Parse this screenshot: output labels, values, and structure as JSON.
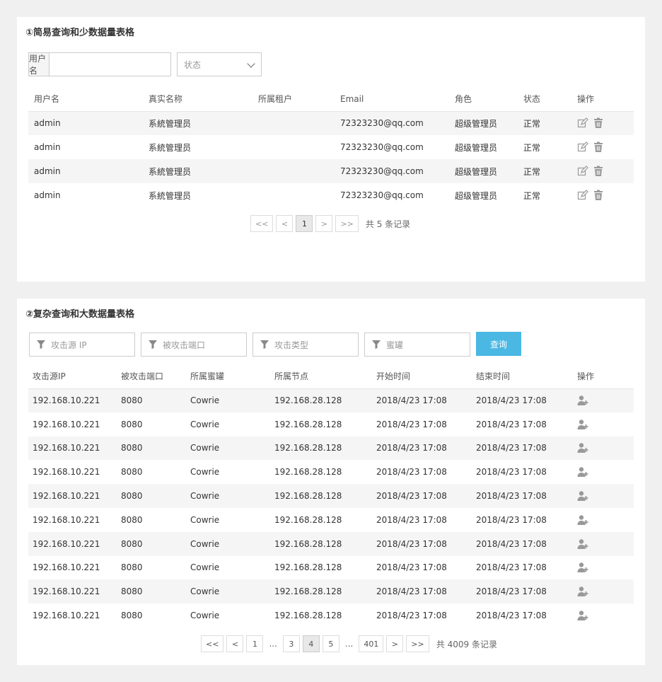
{
  "panel1": {
    "title": "①简易查询和少数据量表格",
    "search": {
      "addon_label": "用户名",
      "input_value": "",
      "status_placeholder": "状态"
    },
    "columns": [
      "用户名",
      "真实名称",
      "所属租户",
      "Email",
      "角色",
      "状态",
      "操作"
    ],
    "rows": [
      [
        "admin",
        "系統管理员",
        "",
        "72323230@qq.com",
        "超级管理员",
        "正常"
      ],
      [
        "admin",
        "系統管理员",
        "",
        "72323230@qq.com",
        "超级管理员",
        "正常"
      ],
      [
        "admin",
        "系統管理员",
        "",
        "72323230@qq.com",
        "超级管理员",
        "正常"
      ],
      [
        "admin",
        "系統管理员",
        "",
        "72323230@qq.com",
        "超级管理员",
        "正常"
      ]
    ],
    "row_actions": [
      "edit-icon",
      "trash-icon"
    ],
    "pager": {
      "first": "<<",
      "prev": "<",
      "current": "1",
      "next": ">",
      "last": ">>",
      "total_text": "共 5 条记录"
    }
  },
  "panel2": {
    "title": "②复杂查询和大数据量表格",
    "filters": [
      "攻击源 IP",
      "被攻击端口",
      "攻击类型",
      "蜜罐"
    ],
    "query_label": "查询",
    "columns": [
      "攻击源IP",
      "被攻击端口",
      "所属蜜罐",
      "所属节点",
      "开始时间",
      "结束时间",
      "操作"
    ],
    "rows": [
      [
        "192.168.10.221",
        "8080",
        "Cowrie",
        "192.168.28.128",
        "2018/4/23 17:08",
        "2018/4/23 17:08"
      ],
      [
        "192.168.10.221",
        "8080",
        "Cowrie",
        "192.168.28.128",
        "2018/4/23 17:08",
        "2018/4/23 17:08"
      ],
      [
        "192.168.10.221",
        "8080",
        "Cowrie",
        "192.168.28.128",
        "2018/4/23 17:08",
        "2018/4/23 17:08"
      ],
      [
        "192.168.10.221",
        "8080",
        "Cowrie",
        "192.168.28.128",
        "2018/4/23 17:08",
        "2018/4/23 17:08"
      ],
      [
        "192.168.10.221",
        "8080",
        "Cowrie",
        "192.168.28.128",
        "2018/4/23 17:08",
        "2018/4/23 17:08"
      ],
      [
        "192.168.10.221",
        "8080",
        "Cowrie",
        "192.168.28.128",
        "2018/4/23 17:08",
        "2018/4/23 17:08"
      ],
      [
        "192.168.10.221",
        "8080",
        "Cowrie",
        "192.168.28.128",
        "2018/4/23 17:08",
        "2018/4/23 17:08"
      ],
      [
        "192.168.10.221",
        "8080",
        "Cowrie",
        "192.168.28.128",
        "2018/4/23 17:08",
        "2018/4/23 17:08"
      ],
      [
        "192.168.10.221",
        "8080",
        "Cowrie",
        "192.168.28.128",
        "2018/4/23 17:08",
        "2018/4/23 17:08"
      ],
      [
        "192.168.10.221",
        "8080",
        "Cowrie",
        "192.168.28.128",
        "2018/4/23 17:08",
        "2018/4/23 17:08"
      ]
    ],
    "row_action": "add-user-icon",
    "pager": {
      "first": "<<",
      "prev": "<",
      "pages": [
        "1",
        "...",
        "3",
        "4",
        "5",
        "...",
        "401"
      ],
      "current": "4",
      "next": ">",
      "last": ">>",
      "total_text": "共 4009 条记录"
    }
  },
  "colors": {
    "accent": "#4ab8e3",
    "background": "#f0f0f0",
    "stripe": "#f5f5f5",
    "icon": "#999999"
  }
}
